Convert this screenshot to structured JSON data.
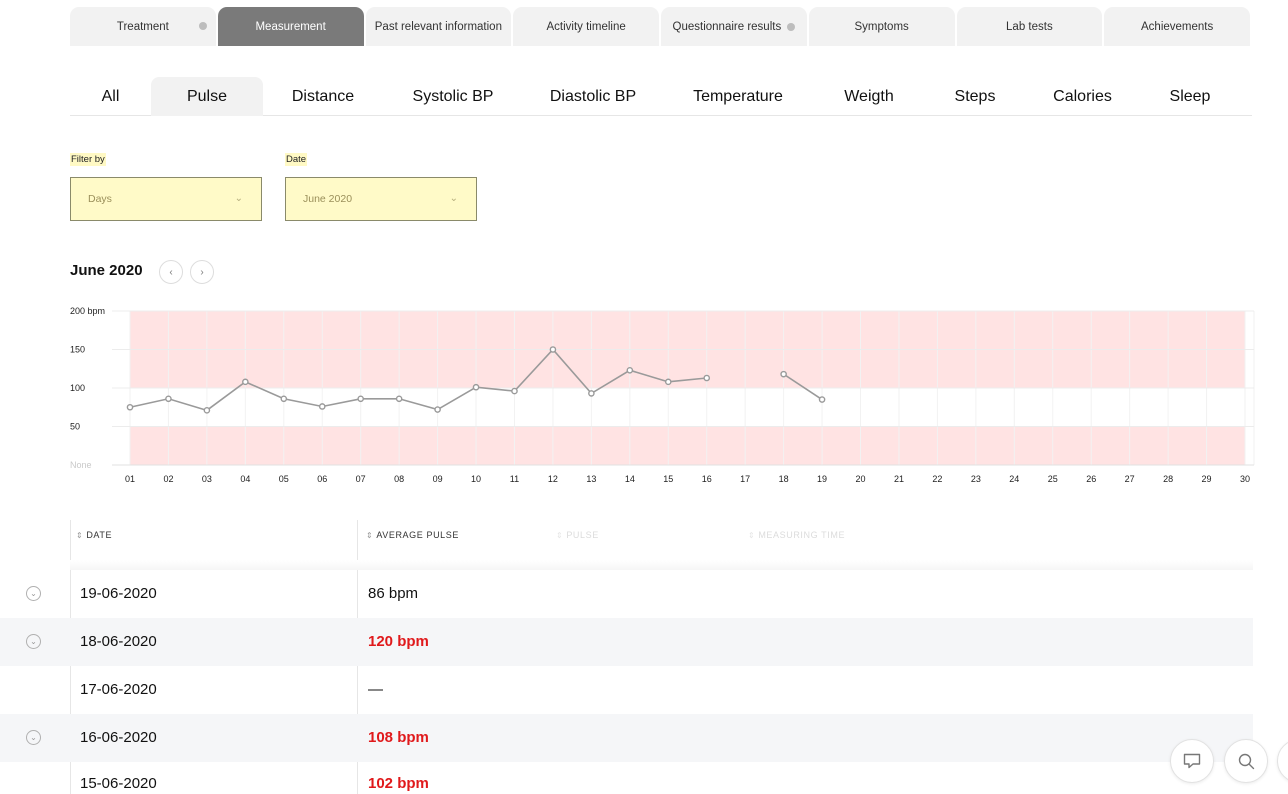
{
  "top_tabs": [
    {
      "label": "Treatment",
      "active": false,
      "dot": true
    },
    {
      "label": "Measurement",
      "active": true,
      "dot": false
    },
    {
      "label": "Past relevant information",
      "active": false,
      "dot": false
    },
    {
      "label": "Activity timeline",
      "active": false,
      "dot": false
    },
    {
      "label": "Questionnaire results",
      "active": false,
      "dot": true
    },
    {
      "label": "Symptoms",
      "active": false,
      "dot": false
    },
    {
      "label": "Lab tests",
      "active": false,
      "dot": false
    },
    {
      "label": "Achievements",
      "active": false,
      "dot": false
    }
  ],
  "sub_tabs": [
    {
      "label": "All",
      "active": false
    },
    {
      "label": "Pulse",
      "active": true
    },
    {
      "label": "Distance",
      "active": false
    },
    {
      "label": "Systolic BP",
      "active": false
    },
    {
      "label": "Diastolic BP",
      "active": false
    },
    {
      "label": "Temperature",
      "active": false
    },
    {
      "label": "Weigth",
      "active": false
    },
    {
      "label": "Steps",
      "active": false
    },
    {
      "label": "Calories",
      "active": false
    },
    {
      "label": "Sleep",
      "active": false
    }
  ],
  "filters": {
    "filter_by_label": "Filter by",
    "filter_by_value": "Days",
    "date_label": "Date",
    "date_value": "June 2020"
  },
  "month": {
    "title": "June 2020",
    "prev_icon": "chevron-left-icon",
    "next_icon": "chevron-right-icon"
  },
  "chart_data": {
    "type": "line",
    "title": "",
    "x": [
      "01",
      "02",
      "03",
      "04",
      "05",
      "06",
      "07",
      "08",
      "09",
      "10",
      "11",
      "12",
      "13",
      "14",
      "15",
      "16",
      "17",
      "18",
      "19",
      "20",
      "21",
      "22",
      "23",
      "24",
      "25",
      "26",
      "27",
      "28",
      "29",
      "30"
    ],
    "series": [
      {
        "values": [
          75,
          86,
          71,
          108,
          86,
          76,
          86,
          86,
          72,
          101,
          96,
          150,
          93,
          123,
          108,
          113,
          null,
          118,
          85,
          null,
          null,
          null,
          null,
          null,
          null,
          null,
          null,
          null,
          null,
          null
        ]
      }
    ],
    "y_ticks": [
      "None",
      "50",
      "100",
      "150",
      "200 bpm"
    ],
    "ylim": [
      0,
      200
    ],
    "normal_range": [
      50,
      100
    ],
    "out_of_range_color": "#ffe3e3",
    "line_color": "#9a9a9a",
    "grid": true
  },
  "table": {
    "headers": [
      "DATE",
      "AVERAGE PULSE",
      "PULSE",
      "MEASURING TIME"
    ],
    "rows": [
      {
        "date": "19-06-2020",
        "value": "86 bpm",
        "high": false,
        "expandable": true
      },
      {
        "date": "18-06-2020",
        "value": "120 bpm",
        "high": true,
        "expandable": true
      },
      {
        "date": "17-06-2020",
        "value": "—",
        "high": false,
        "expandable": false
      },
      {
        "date": "16-06-2020",
        "value": "108 bpm",
        "high": true,
        "expandable": true
      },
      {
        "date": "15-06-2020",
        "value": "102 bpm",
        "high": true,
        "expandable": false
      }
    ]
  },
  "colors": {
    "alert": "#e0191b",
    "filter_bg": "#fffac8",
    "active_tab": "#7a7a7a"
  },
  "fabs": [
    "chat-icon",
    "search-icon"
  ]
}
